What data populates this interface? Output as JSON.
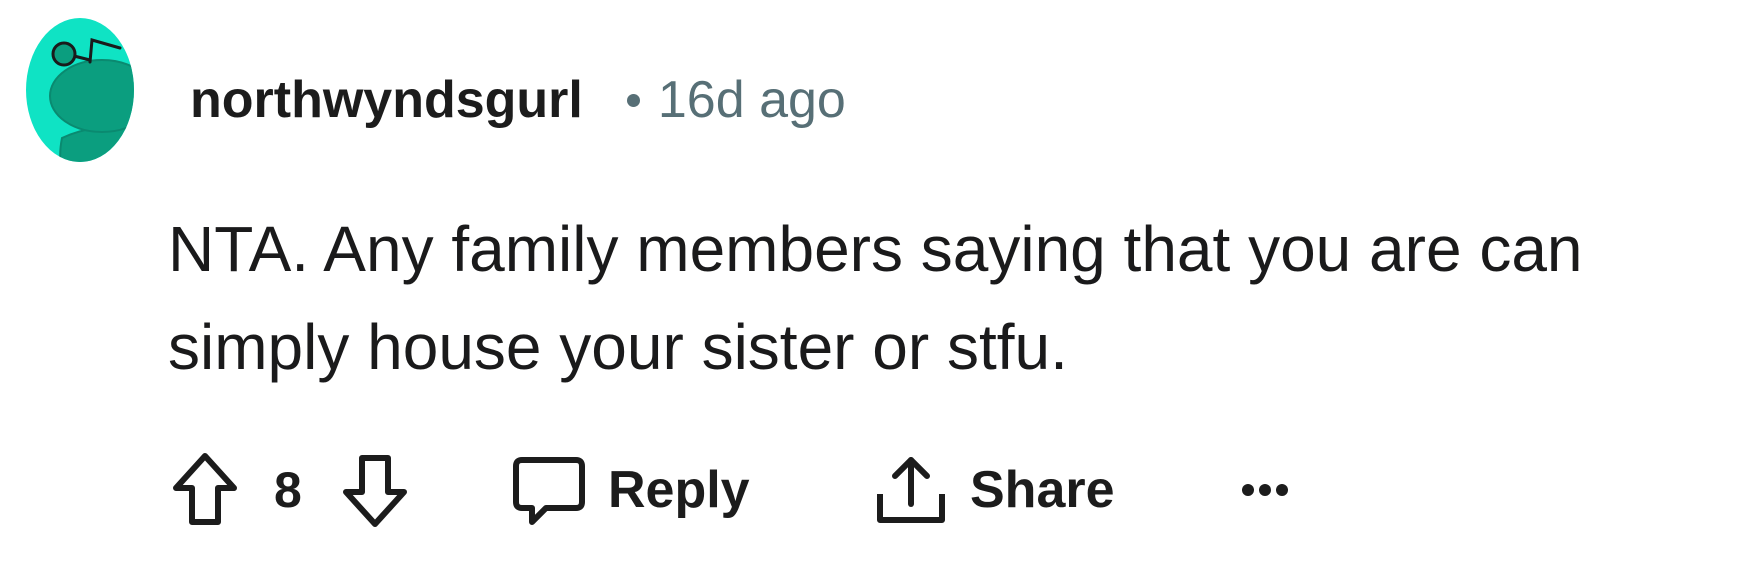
{
  "comment": {
    "author": "northwyndsgurl",
    "separator": "•",
    "timestamp": "16d ago",
    "text": "NTA. Any family members saying that you are can simply house your sister or stfu."
  },
  "actions": {
    "upvote_icon": "arrow-up-icon",
    "vote_count": "8",
    "downvote_icon": "arrow-down-icon",
    "reply_icon": "speech-bubble-icon",
    "reply_label": "Reply",
    "share_icon": "share-upload-icon",
    "share_label": "Share",
    "more_icon": "ellipsis-icon"
  },
  "colors": {
    "avatar_background": "#0fe3c4",
    "avatar_snoo": "#0b9e7f",
    "text_primary": "#1a1a1b",
    "text_meta": "#576f76"
  }
}
